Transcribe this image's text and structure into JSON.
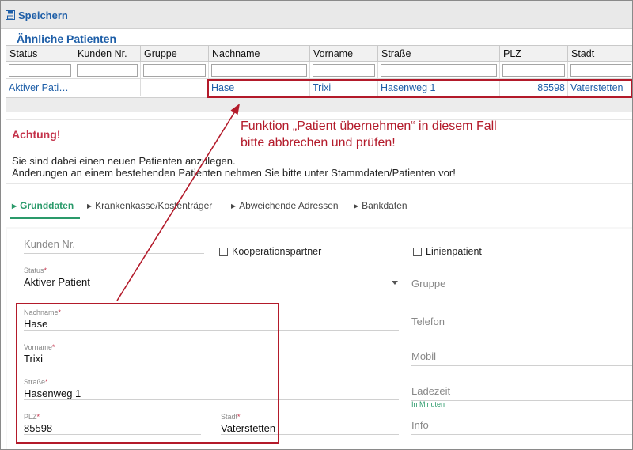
{
  "toolbar": {
    "save_label": "Speichern"
  },
  "similar": {
    "title": "Ähnliche Patienten",
    "columns": [
      "Status",
      "Kunden Nr.",
      "Gruppe",
      "Nachname",
      "Vorname",
      "Straße",
      "PLZ",
      "Stadt"
    ],
    "row": {
      "status": "Aktiver Patient",
      "kunden_nr": "",
      "gruppe": "",
      "nachname": "Hase",
      "vorname": "Trixi",
      "strasse": "Hasenweg 1",
      "plz": "85598",
      "stadt": "Vaterstetten"
    }
  },
  "warning": {
    "title": "Achtung!",
    "line1": "Sie sind dabei einen neuen Patienten anzulegen.",
    "line2": "Änderungen an einem bestehenden Patienten nehmen Sie bitte unter Stammdaten/Patienten vor!"
  },
  "annotation": {
    "line1": "Funktion „Patient übernehmen“ in diesem Fall",
    "line2": "bitte abbrechen und prüfen!",
    "color": "#b31a2a"
  },
  "tabs": [
    {
      "label": "Grunddaten",
      "active": true
    },
    {
      "label": "Krankenkasse/Kostenträger",
      "active": false
    },
    {
      "label": "Abweichende Adressen",
      "active": false
    },
    {
      "label": "Bankdaten",
      "active": false
    }
  ],
  "form": {
    "kunden_nr_placeholder": "Kunden Nr.",
    "kooperationspartner": "Kooperationspartner",
    "linienpatient": "Linienpatient",
    "status_label": "Status",
    "status_value": "Aktiver Patient",
    "gruppe_placeholder": "Gruppe",
    "nachname_label": "Nachname",
    "nachname_value": "Hase",
    "telefon_placeholder": "Telefon",
    "vorname_label": "Vorname",
    "vorname_value": "Trixi",
    "mobil_placeholder": "Mobil",
    "strasse_label": "Straße",
    "strasse_value": "Hasenweg 1",
    "ladezeit_placeholder": "Ladezeit",
    "ladezeit_hint": "In Minuten",
    "plz_label": "PLZ",
    "plz_value": "85598",
    "stadt_label": "Stadt",
    "stadt_value": "Vaterstetten",
    "info_placeholder": "Info",
    "required_mark": "*"
  },
  "colors": {
    "accent_blue": "#1f5fa8",
    "accent_green": "#2a9a6a",
    "warning_red": "#c4324a"
  }
}
